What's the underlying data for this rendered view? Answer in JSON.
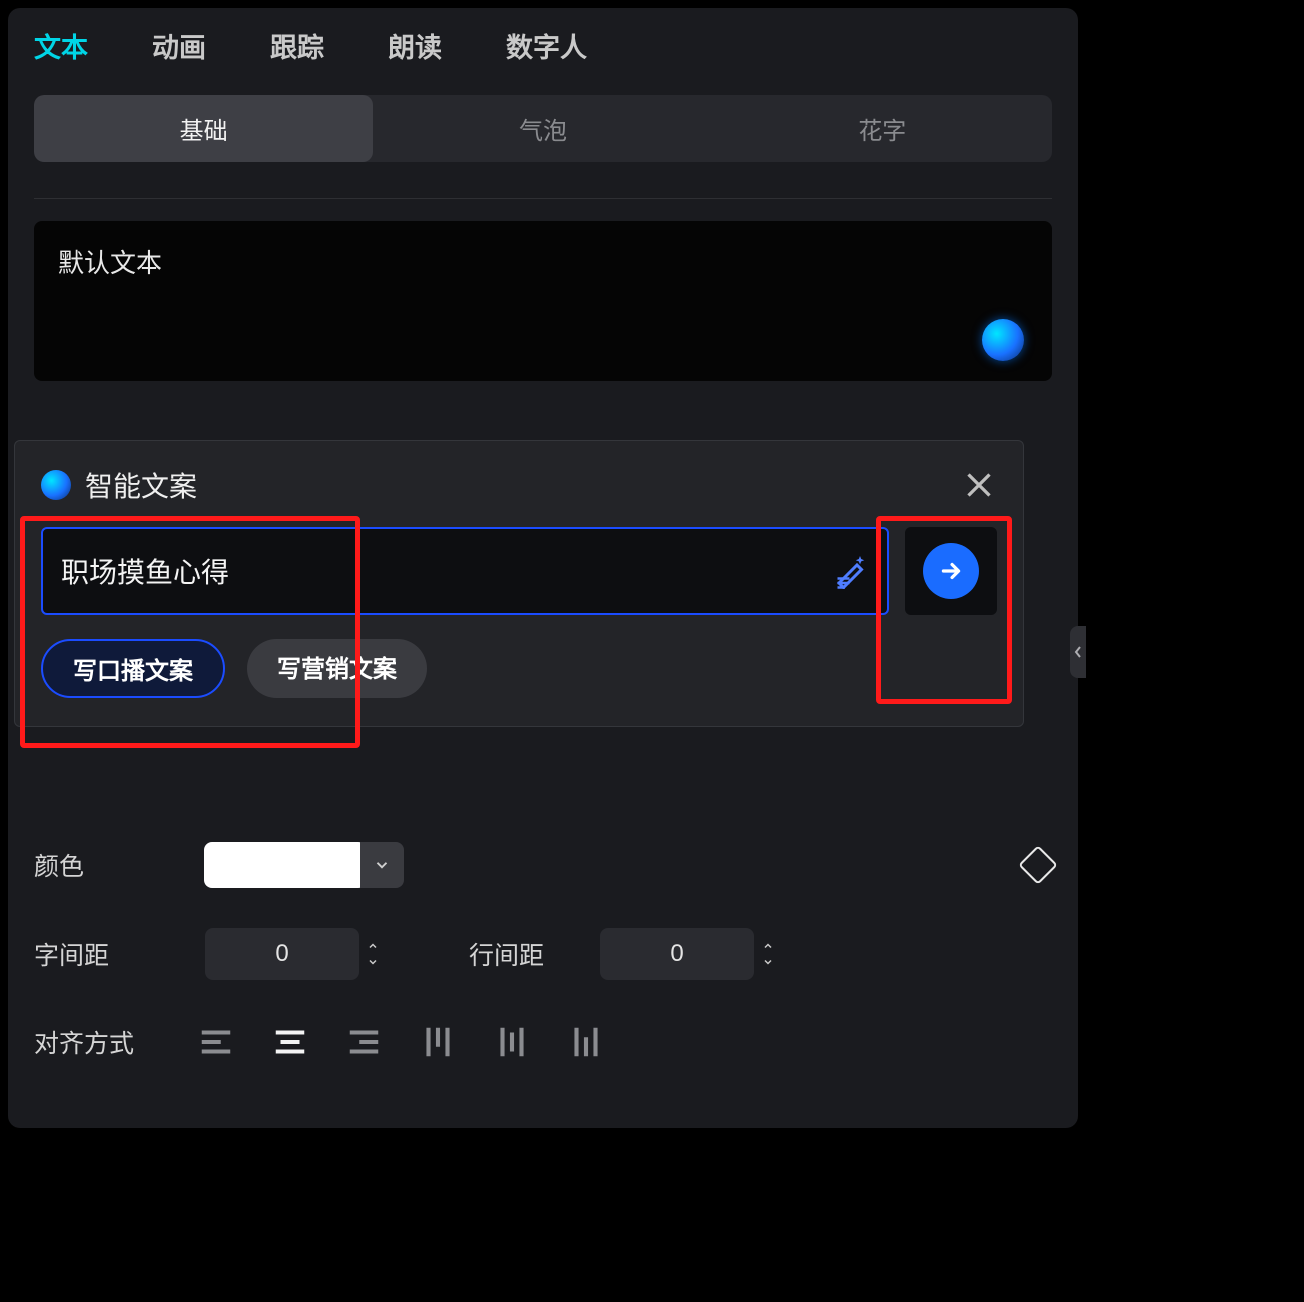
{
  "topTabs": {
    "items": [
      "文本",
      "动画",
      "跟踪",
      "朗读",
      "数字人"
    ],
    "activeIndex": 0
  },
  "subTabs": {
    "items": [
      "基础",
      "气泡",
      "花字"
    ],
    "activeIndex": 0
  },
  "textBox": {
    "value": "默认文本"
  },
  "popup": {
    "title": "智能文案",
    "inputValue": "职场摸鱼心得",
    "chips": [
      "写口播文案",
      "写营销文案"
    ],
    "chipActiveIndex": 0
  },
  "controls": {
    "colorLabel": "颜色",
    "colorValue": "#ffffff",
    "letterSpacingLabel": "字间距",
    "letterSpacingValue": "0",
    "lineSpacingLabel": "行间距",
    "lineSpacingValue": "0",
    "alignLabel": "对齐方式",
    "alignActiveIndex": 1
  }
}
